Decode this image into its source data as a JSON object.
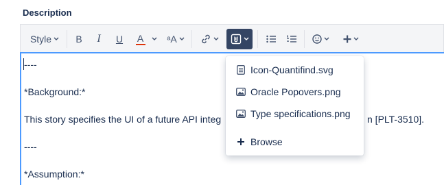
{
  "field": {
    "label": "Description"
  },
  "toolbar": {
    "style_label": "Style",
    "bold": "B",
    "italic": "I",
    "underline": "U",
    "text_color": "A",
    "text_color_accent": "#de350b",
    "more_format": "ᵃA"
  },
  "editor": {
    "lines": [
      "----",
      "*Background:*",
      "This story specifies the UI of a future API integ",
      "n [PLT-3510].",
      "----",
      "*Assumption:*"
    ]
  },
  "attachments_menu": {
    "items": [
      {
        "label": "Icon-Quantifind.svg",
        "icon": "document-icon"
      },
      {
        "label": "Oracle Popovers.png",
        "icon": "image-icon"
      },
      {
        "label": "Type specifications.png",
        "icon": "image-icon"
      }
    ],
    "browse": {
      "label": "Browse",
      "icon": "plus-icon"
    }
  }
}
